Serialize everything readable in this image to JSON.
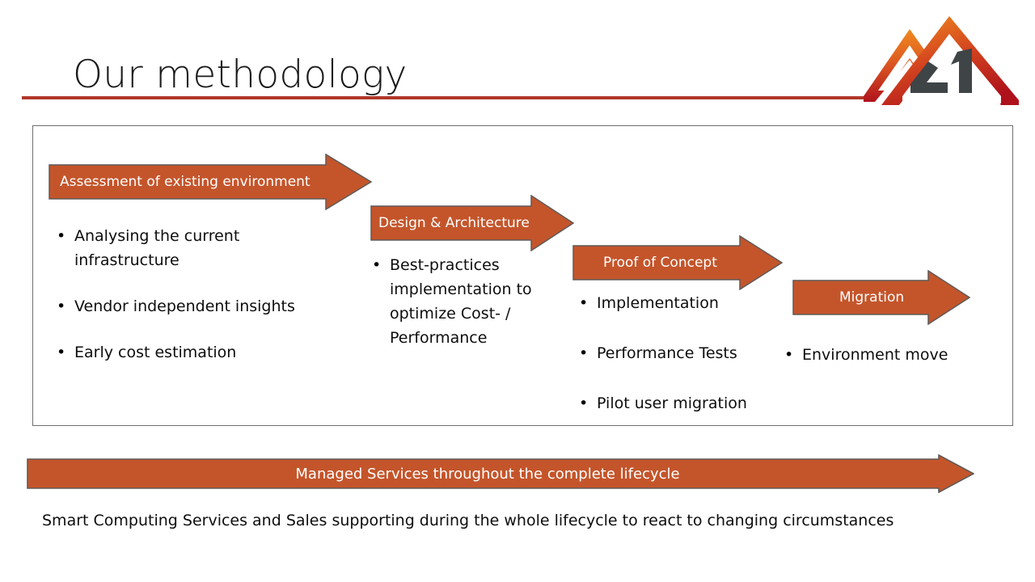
{
  "slide": {
    "title": "Our methodology",
    "accent_rule_color": "#b1382a",
    "arrow_fill_color": "#c4552b",
    "arrow_border_color": "#5f5a57",
    "panel_border_color": "#6f6f6f",
    "background_color": "#ffffff"
  },
  "logo": {
    "name": "company-mountain-logo",
    "gradient_from": "#ef8022",
    "gradient_to": "#b4151c",
    "dark_mark_color": "#3f4447",
    "dark_mark_text": "21"
  },
  "stages": [
    {
      "id": "assessment",
      "label": "Assessment of existing environment",
      "bullets": [
        "Analysing the current infrastructure",
        "Vendor independent insights",
        "Early cost estimation"
      ]
    },
    {
      "id": "design",
      "label": "Design & Architecture",
      "bullets": [
        "Best-practices implementation to optimize Cost- / Performance"
      ]
    },
    {
      "id": "poc",
      "label": "Proof of Concept",
      "bullets": [
        "Implementation",
        "Performance Tests",
        "Pilot user migration"
      ]
    },
    {
      "id": "migration",
      "label": "Migration",
      "bullets": [
        "Environment move"
      ]
    }
  ],
  "bullet_glyph": "•",
  "bottom_arrow": {
    "label": "Managed Services throughout the complete lifecycle"
  },
  "footer": {
    "caption": "Smart Computing Services and Sales supporting during the whole lifecycle to react to changing circumstances"
  }
}
